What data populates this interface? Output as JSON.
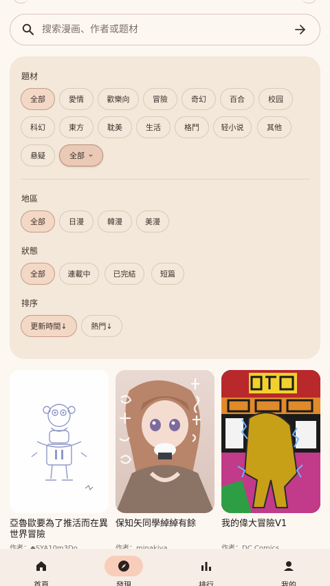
{
  "search": {
    "placeholder": "搜索漫画、作者或题材",
    "value": ""
  },
  "filters": {
    "genre": {
      "label": "題材",
      "options": [
        "全部",
        "愛情",
        "歡樂向",
        "冒險",
        "奇幻",
        "百合",
        "校园",
        "科幻",
        "東方",
        "耽美",
        "生活",
        "格鬥",
        "轻小说",
        "其他",
        "悬疑"
      ],
      "selected": "全部",
      "more_label": "全部"
    },
    "region": {
      "label": "地區",
      "options": [
        "全部",
        "日漫",
        "韓漫",
        "美漫"
      ],
      "selected": "全部"
    },
    "status": {
      "label": "狀態",
      "options": [
        "全部",
        "連載中",
        "已完結",
        "短篇"
      ],
      "selected": "全部"
    },
    "sort": {
      "label": "排序",
      "options": [
        "更新時間↓",
        "熱門↓"
      ],
      "selected": "更新時間↓"
    }
  },
  "comics": [
    {
      "title": "亞魯歐要為了推活而在異世界冒險",
      "author": "作者：◆SYA10m3Do"
    },
    {
      "title": "保知矢同學綽綽有餘",
      "author": "作者：minakiya"
    },
    {
      "title": "我的偉大冒險V1",
      "author": "作者：DC Comics"
    }
  ],
  "nav": [
    {
      "label": "首頁",
      "icon": "home-icon"
    },
    {
      "label": "發現",
      "icon": "compass-icon",
      "active": true
    },
    {
      "label": "排行",
      "icon": "bar-chart-icon"
    },
    {
      "label": "我的",
      "icon": "person-icon"
    }
  ],
  "colors": {
    "background": "#fdf7f2",
    "panel": "#f3e8d9",
    "chip_selected": "#f4d8c6",
    "nav_active": "#f8cdb9"
  }
}
